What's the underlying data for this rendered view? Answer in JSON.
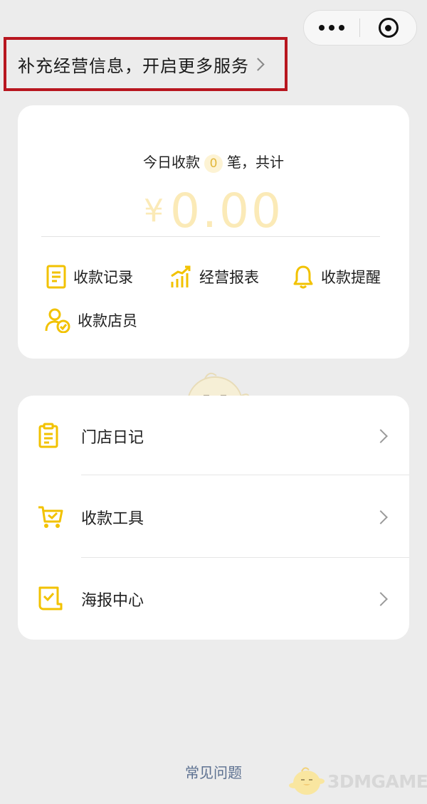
{
  "capsule": {
    "more_icon": "more-dots-icon",
    "close_icon": "target-circle-icon"
  },
  "banner": {
    "text": "补充经营信息，开启更多服务",
    "chevron_icon": "chevron-right-icon",
    "highlight_color": "#b8161f"
  },
  "summary": {
    "prefix": "今日收款",
    "count": "0",
    "suffix": "笔，共计",
    "currency": "¥",
    "amount": "0.00",
    "amount_color": "#fbeab7"
  },
  "quick_actions": [
    {
      "label": "收款记录",
      "icon": "document-icon"
    },
    {
      "label": "经营报表",
      "icon": "growth-chart-icon"
    },
    {
      "label": "收款提醒",
      "icon": "bell-icon"
    },
    {
      "label": "收款店员",
      "icon": "staff-check-icon"
    }
  ],
  "menu": [
    {
      "label": "门店日记",
      "icon": "clipboard-icon"
    },
    {
      "label": "收款工具",
      "icon": "cart-check-icon"
    },
    {
      "label": "海报中心",
      "icon": "poster-check-icon"
    }
  ],
  "footer": {
    "faq": "常见问题",
    "watermark": "3DMGAME"
  },
  "accent_color": "#f2c200"
}
